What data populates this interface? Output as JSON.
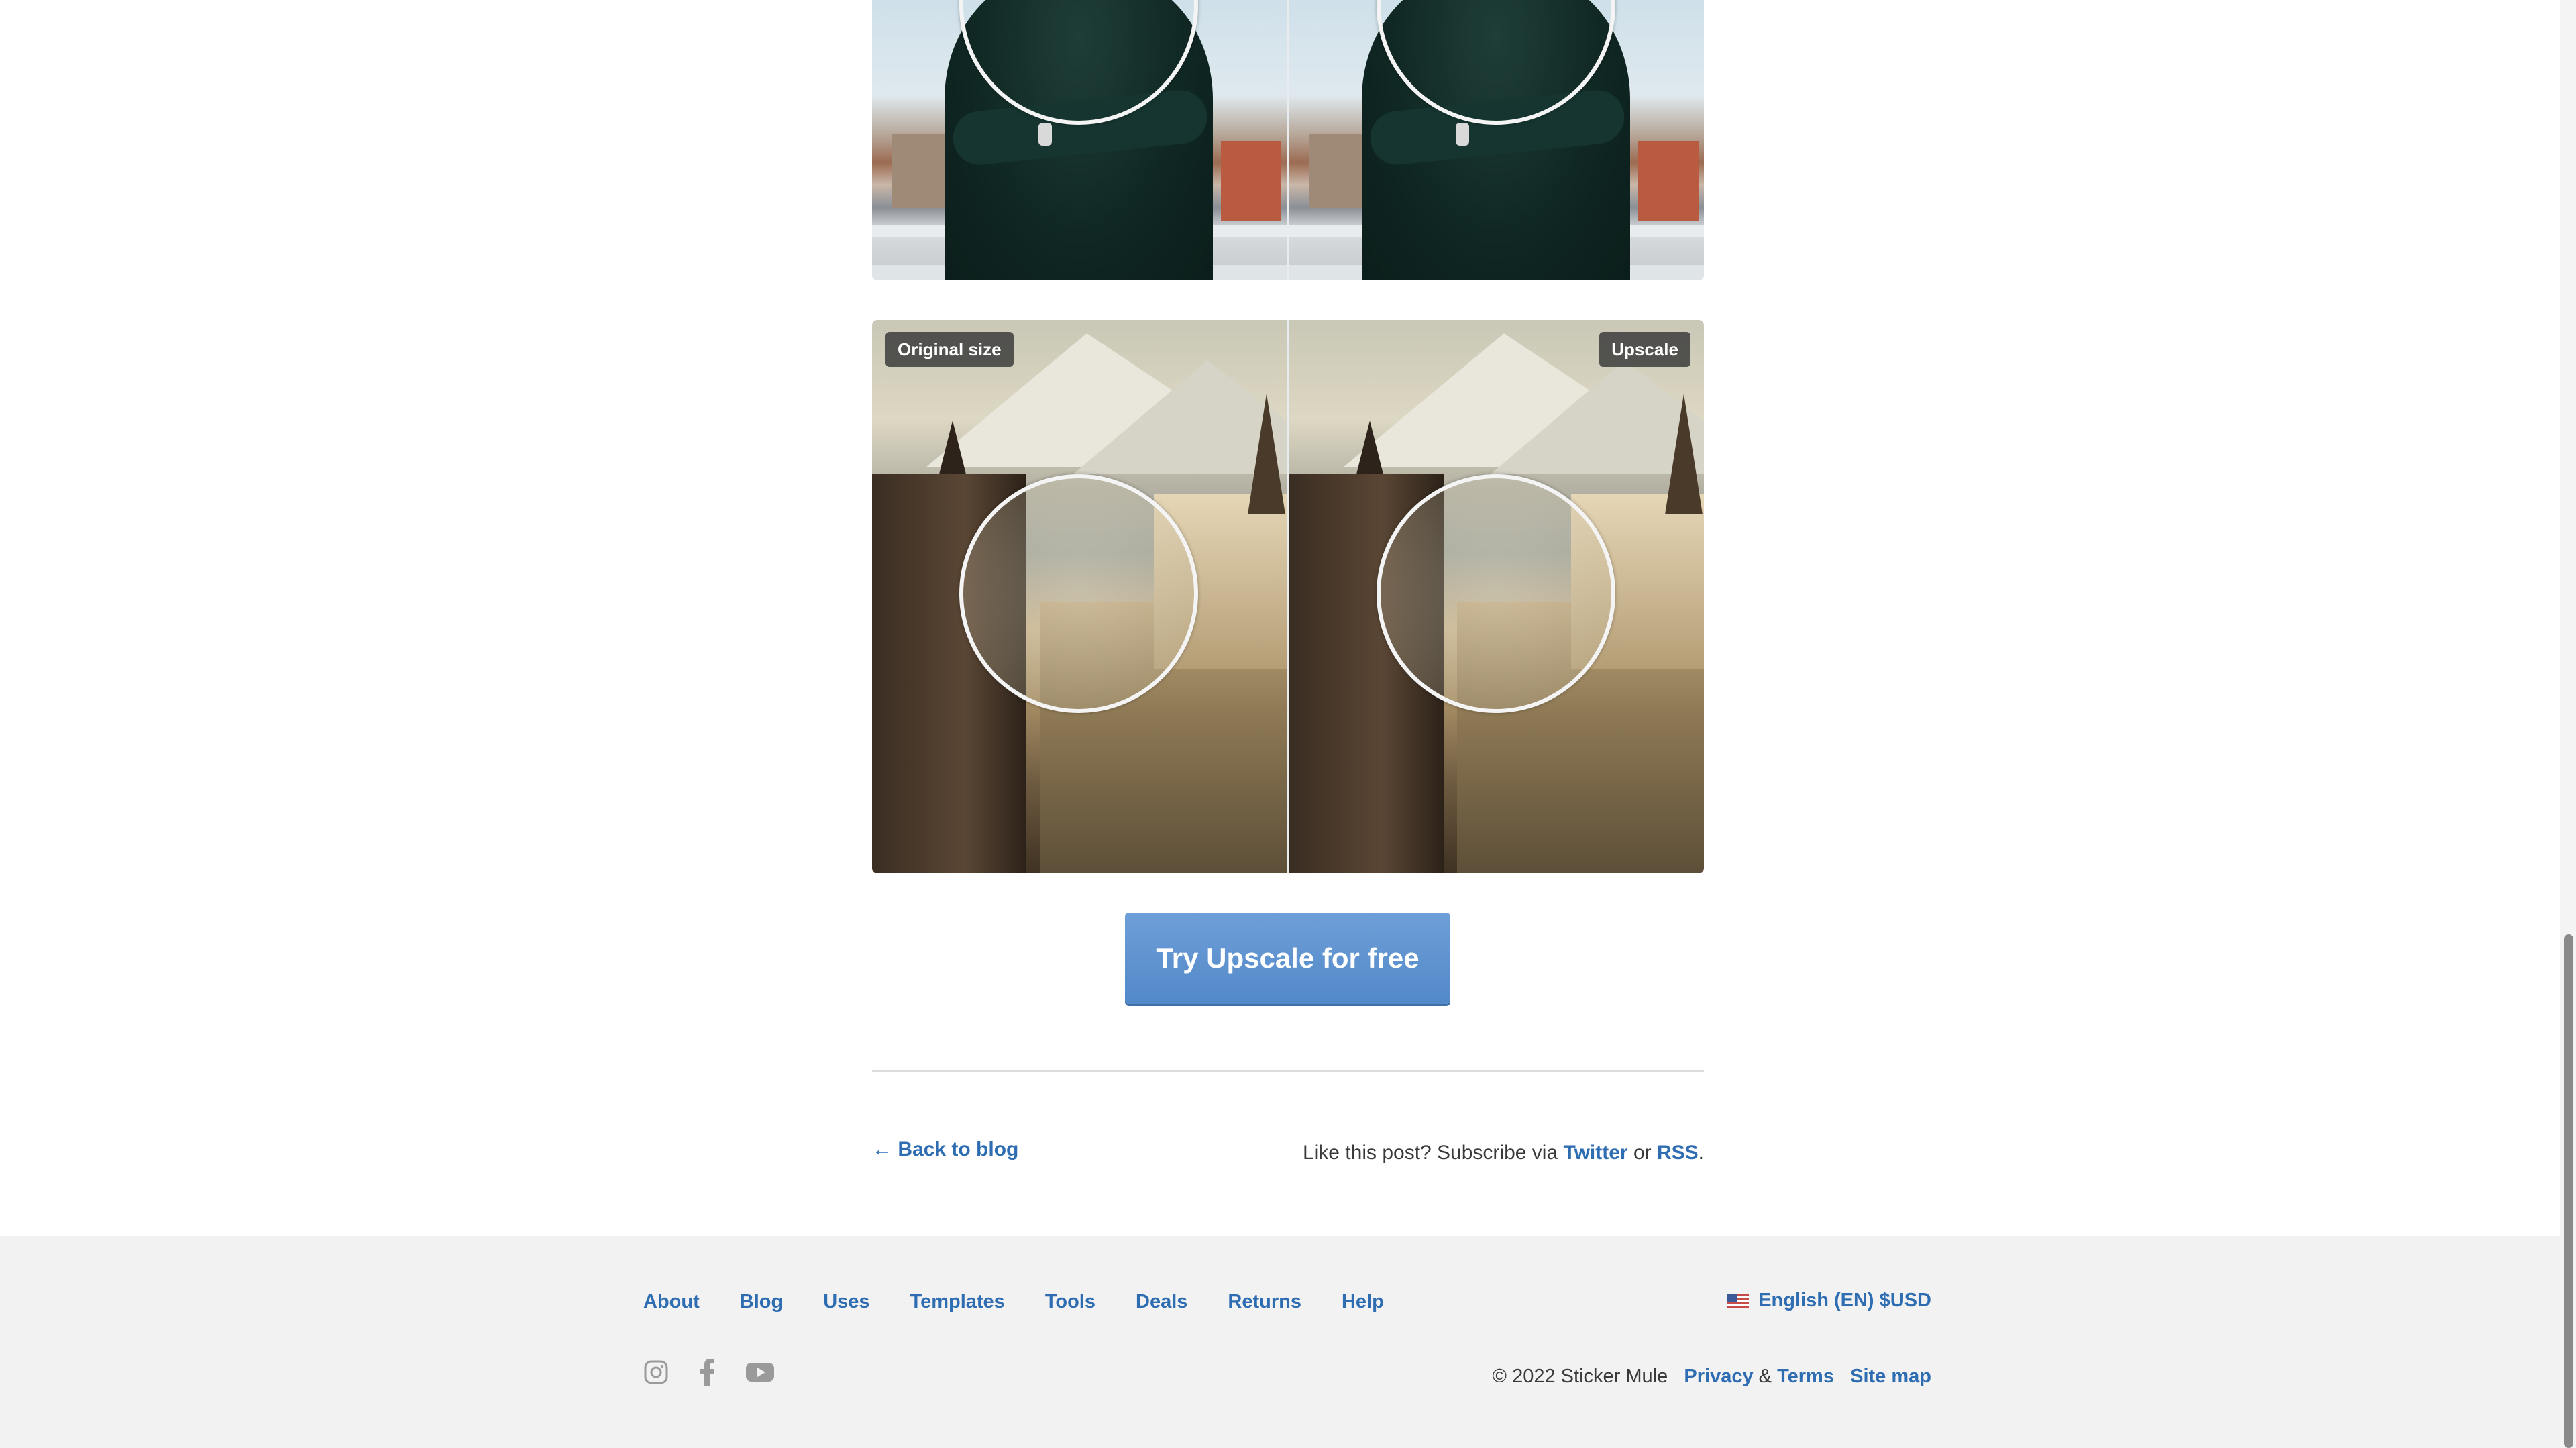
{
  "comparison_labels": {
    "original": "Original size",
    "upscale": "Upscale"
  },
  "cta": {
    "label": "Try Upscale for free"
  },
  "post_footer": {
    "back_link": "← Back to blog",
    "subscribe_prefix": "Like this post? Subscribe via",
    "twitter": "Twitter",
    "or": "or",
    "rss": "RSS",
    "period": "."
  },
  "footer": {
    "nav": [
      "About",
      "Blog",
      "Uses",
      "Templates",
      "Tools",
      "Deals",
      "Returns",
      "Help"
    ],
    "language": "English (EN) $USD",
    "social_icons": [
      "instagram-icon",
      "facebook-icon",
      "youtube-icon"
    ],
    "copyright": "© 2022 Sticker Mule",
    "privacy": "Privacy",
    "amp": "&",
    "terms": "Terms",
    "sitemap": "Site map"
  },
  "colors": {
    "link": "#2f6db3",
    "cta": "#5d93d1",
    "footer_bg": "#f2f2f2"
  }
}
